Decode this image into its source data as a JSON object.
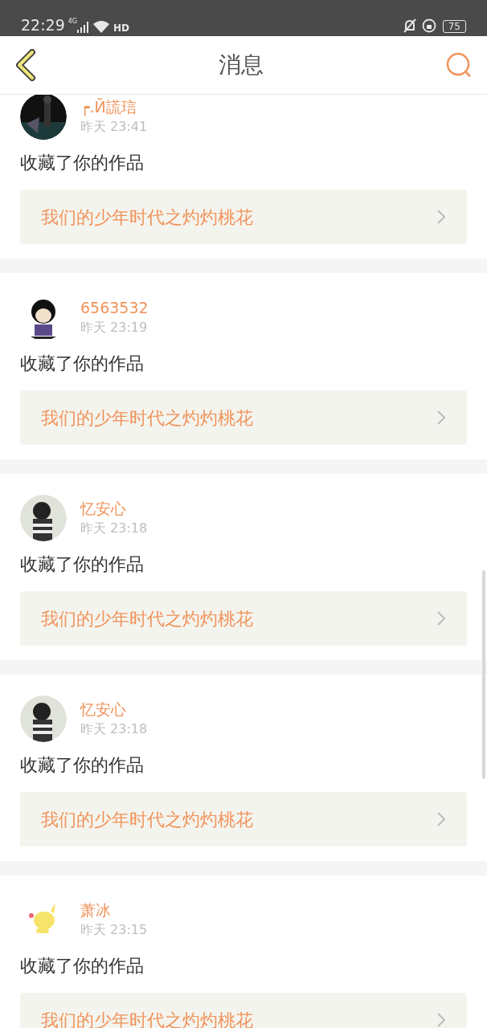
{
  "status_bar": {
    "time": "22:29",
    "network": "4G",
    "hd": "HD",
    "battery": "75"
  },
  "header": {
    "title": "消息"
  },
  "messages": [
    {
      "user": "┍.Й謊琂",
      "time": "昨天 23:41",
      "action": "收藏了你的作品",
      "work": "我们的少年时代之灼灼桃花"
    },
    {
      "user": "6563532",
      "time": "昨天 23:19",
      "action": "收藏了你的作品",
      "work": "我们的少年时代之灼灼桃花"
    },
    {
      "user": "忆安心",
      "time": "昨天 23:18",
      "action": "收藏了你的作品",
      "work": "我们的少年时代之灼灼桃花"
    },
    {
      "user": "忆安心",
      "time": "昨天 23:18",
      "action": "收藏了你的作品",
      "work": "我们的少年时代之灼灼桃花"
    },
    {
      "user": "萧冰",
      "time": "昨天 23:15",
      "action": "收藏了你的作品",
      "work": "我们的少年时代之灼灼桃花"
    }
  ]
}
